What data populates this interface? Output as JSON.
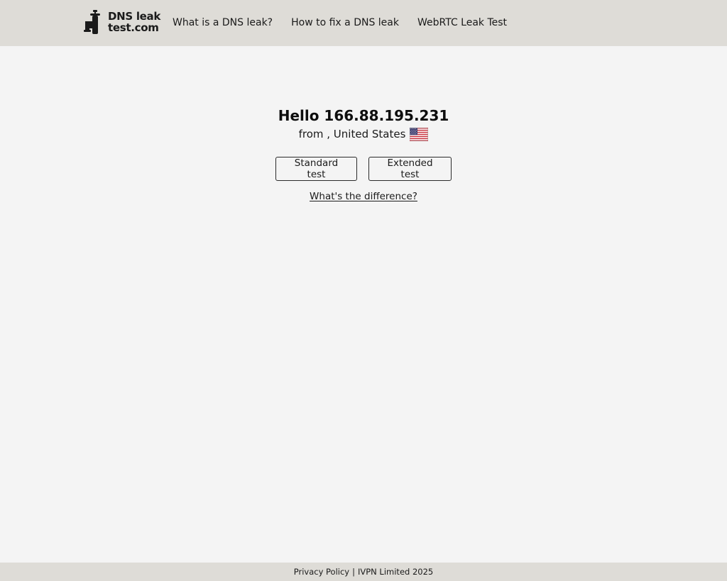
{
  "header": {
    "logo": {
      "line1": "DNS leak",
      "line2": "test.com",
      "icon": "faucet-icon"
    },
    "nav": [
      {
        "label": "What is a DNS leak?"
      },
      {
        "label": "How to fix a DNS leak"
      },
      {
        "label": "WebRTC Leak Test"
      }
    ]
  },
  "main": {
    "greeting": "Hello 166.88.195.231",
    "location": "from , United States",
    "flag_icon": "us-flag-icon",
    "buttons": {
      "standard": "Standard test",
      "extended": "Extended test"
    },
    "difference_link": "What's the difference?"
  },
  "footer": {
    "privacy": "Privacy Policy",
    "separator": "|",
    "company": "IVPN Limited 2025"
  },
  "colors": {
    "header_bg": "#dedcd7",
    "page_bg": "#f4f4f4",
    "text": "#111111"
  }
}
